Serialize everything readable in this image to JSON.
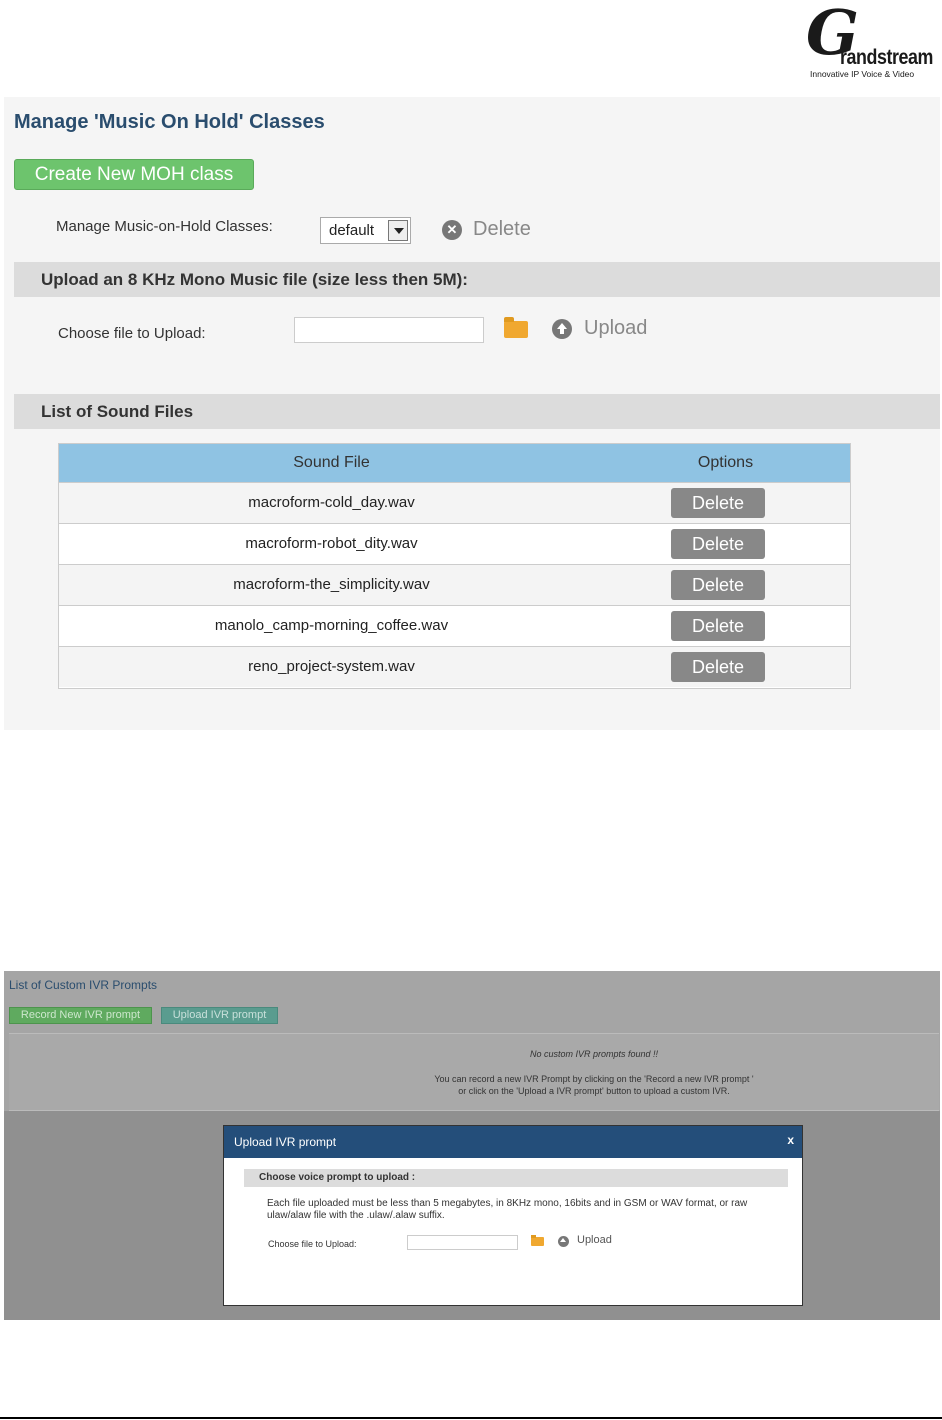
{
  "logo": {
    "letter": "G",
    "word": "randstream",
    "tagline": "Innovative IP Voice & Video"
  },
  "moh_panel": {
    "title": "Manage 'Music On Hold' Classes",
    "create_button": "Create New MOH class",
    "manage_label": "Manage Music-on-Hold Classes:",
    "selected_class": "default",
    "delete_label": "Delete",
    "upload_header": "Upload an 8 KHz Mono Music file (size less then 5M):",
    "choose_file_label": "Choose file to Upload:",
    "upload_label": "Upload",
    "list_header": "List of Sound Files",
    "table": {
      "columns": [
        "Sound File",
        "Options"
      ],
      "rows": [
        {
          "file": "macroform-cold_day.wav",
          "action": "Delete"
        },
        {
          "file": "macroform-robot_dity.wav",
          "action": "Delete"
        },
        {
          "file": "macroform-the_simplicity.wav",
          "action": "Delete"
        },
        {
          "file": "manolo_camp-morning_coffee.wav",
          "action": "Delete"
        },
        {
          "file": "reno_project-system.wav",
          "action": "Delete"
        }
      ]
    }
  },
  "ivr_panel": {
    "title": "List of Custom IVR Prompts",
    "record_button": "Record New IVR prompt",
    "upload_button": "Upload IVR prompt",
    "no_prompts": "No custom IVR prompts found !!",
    "hint_line1": "You can record a new IVR Prompt by clicking on the 'Record a new IVR prompt '",
    "hint_line2": "or click on the 'Upload a IVR prompt' button to upload a custom IVR.",
    "modal": {
      "title": "Upload IVR prompt",
      "close": "x",
      "section": "Choose voice prompt to upload :",
      "desc_line1": "Each file uploaded must be less than 5 megabytes, in 8KHz mono, 16bits and in GSM or WAV format, or raw",
      "desc_line2": "ulaw/alaw file with the .ulaw/.alaw suffix.",
      "choose_file_label": "Choose file to Upload:",
      "upload_label": "Upload"
    }
  },
  "colors": {
    "title_blue": "#2a4d6e",
    "create_green": "#6dc46d",
    "table_header": "#8fc3e3",
    "modal_header": "#244e7a",
    "folder_orange": "#f0a830"
  }
}
